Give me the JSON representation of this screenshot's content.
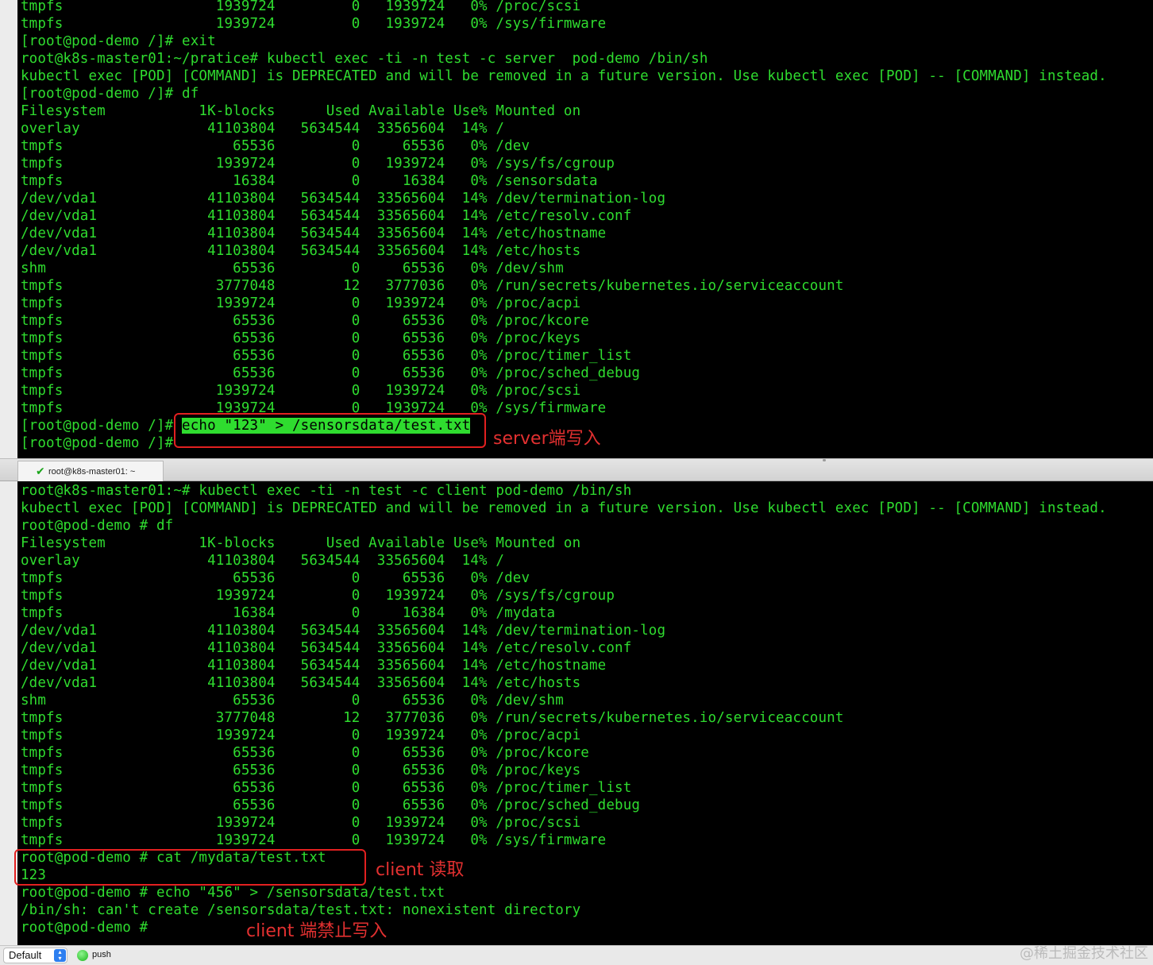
{
  "top_pane": {
    "lines": [
      "tmpfs                  1939724         0   1939724   0% /proc/scsi",
      "tmpfs                  1939724         0   1939724   0% /sys/firmware",
      "[root@pod-demo /]# exit",
      "root@k8s-master01:~/pratice# kubectl exec -ti -n test -c server  pod-demo /bin/sh",
      "kubectl exec [POD] [COMMAND] is DEPRECATED and will be removed in a future version. Use kubectl exec [POD] -- [COMMAND] instead.",
      "[root@pod-demo /]# df",
      "Filesystem           1K-blocks      Used Available Use% Mounted on",
      "overlay               41103804   5634544  33565604  14% /",
      "tmpfs                    65536         0     65536   0% /dev",
      "tmpfs                  1939724         0   1939724   0% /sys/fs/cgroup",
      "tmpfs                    16384         0     16384   0% /sensorsdata",
      "/dev/vda1             41103804   5634544  33565604  14% /dev/termination-log",
      "/dev/vda1             41103804   5634544  33565604  14% /etc/resolv.conf",
      "/dev/vda1             41103804   5634544  33565604  14% /etc/hostname",
      "/dev/vda1             41103804   5634544  33565604  14% /etc/hosts",
      "shm                      65536         0     65536   0% /dev/shm",
      "tmpfs                  3777048        12   3777036   0% /run/secrets/kubernetes.io/serviceaccount",
      "tmpfs                  1939724         0   1939724   0% /proc/acpi",
      "tmpfs                    65536         0     65536   0% /proc/kcore",
      "tmpfs                    65536         0     65536   0% /proc/keys",
      "tmpfs                    65536         0     65536   0% /proc/timer_list",
      "tmpfs                    65536         0     65536   0% /proc/sched_debug",
      "tmpfs                  1939724         0   1939724   0% /proc/scsi",
      "tmpfs                  1939724         0   1939724   0% /sys/firmware"
    ],
    "echo_prompt": "[root@pod-demo /]# ",
    "echo_command": "echo \"123\" > /sensorsdata/test.txt",
    "last_prompt": "[root@pod-demo /]# "
  },
  "tab": {
    "label": "root@k8s-master01: ~",
    "check": "✔"
  },
  "bottom_pane": {
    "lines": [
      "root@k8s-master01:~# kubectl exec -ti -n test -c client pod-demo /bin/sh",
      "kubectl exec [POD] [COMMAND] is DEPRECATED and will be removed in a future version. Use kubectl exec [POD] -- [COMMAND] instead.",
      "root@pod-demo # df",
      "Filesystem           1K-blocks      Used Available Use% Mounted on",
      "overlay               41103804   5634544  33565604  14% /",
      "tmpfs                    65536         0     65536   0% /dev",
      "tmpfs                  1939724         0   1939724   0% /sys/fs/cgroup",
      "tmpfs                    16384         0     16384   0% /mydata",
      "/dev/vda1             41103804   5634544  33565604  14% /dev/termination-log",
      "/dev/vda1             41103804   5634544  33565604  14% /etc/resolv.conf",
      "/dev/vda1             41103804   5634544  33565604  14% /etc/hostname",
      "/dev/vda1             41103804   5634544  33565604  14% /etc/hosts",
      "shm                      65536         0     65536   0% /dev/shm",
      "tmpfs                  3777048        12   3777036   0% /run/secrets/kubernetes.io/serviceaccount",
      "tmpfs                  1939724         0   1939724   0% /proc/acpi",
      "tmpfs                    65536         0     65536   0% /proc/kcore",
      "tmpfs                    65536         0     65536   0% /proc/keys",
      "tmpfs                    65536         0     65536   0% /proc/timer_list",
      "tmpfs                    65536         0     65536   0% /proc/sched_debug",
      "tmpfs                  1939724         0   1939724   0% /proc/scsi",
      "tmpfs                  1939724         0   1939724   0% /sys/firmware",
      "root@pod-demo # cat /mydata/test.txt",
      "123",
      "root@pod-demo # echo \"456\" > /sensorsdata/test.txt",
      "/bin/sh: can't create /sensorsdata/test.txt: nonexistent directory",
      "root@pod-demo # "
    ]
  },
  "annotations": {
    "server_write": "server端写入",
    "client_read": "client 读取",
    "client_denied": "client 端禁止写入",
    "color": "#e22020"
  },
  "statusbar": {
    "profile": "Default",
    "push_label": "push"
  },
  "watermark": "@稀土掘金技术社区",
  "colors": {
    "terminal_bg": "#000000",
    "terminal_fg": "#2fdc2f"
  }
}
